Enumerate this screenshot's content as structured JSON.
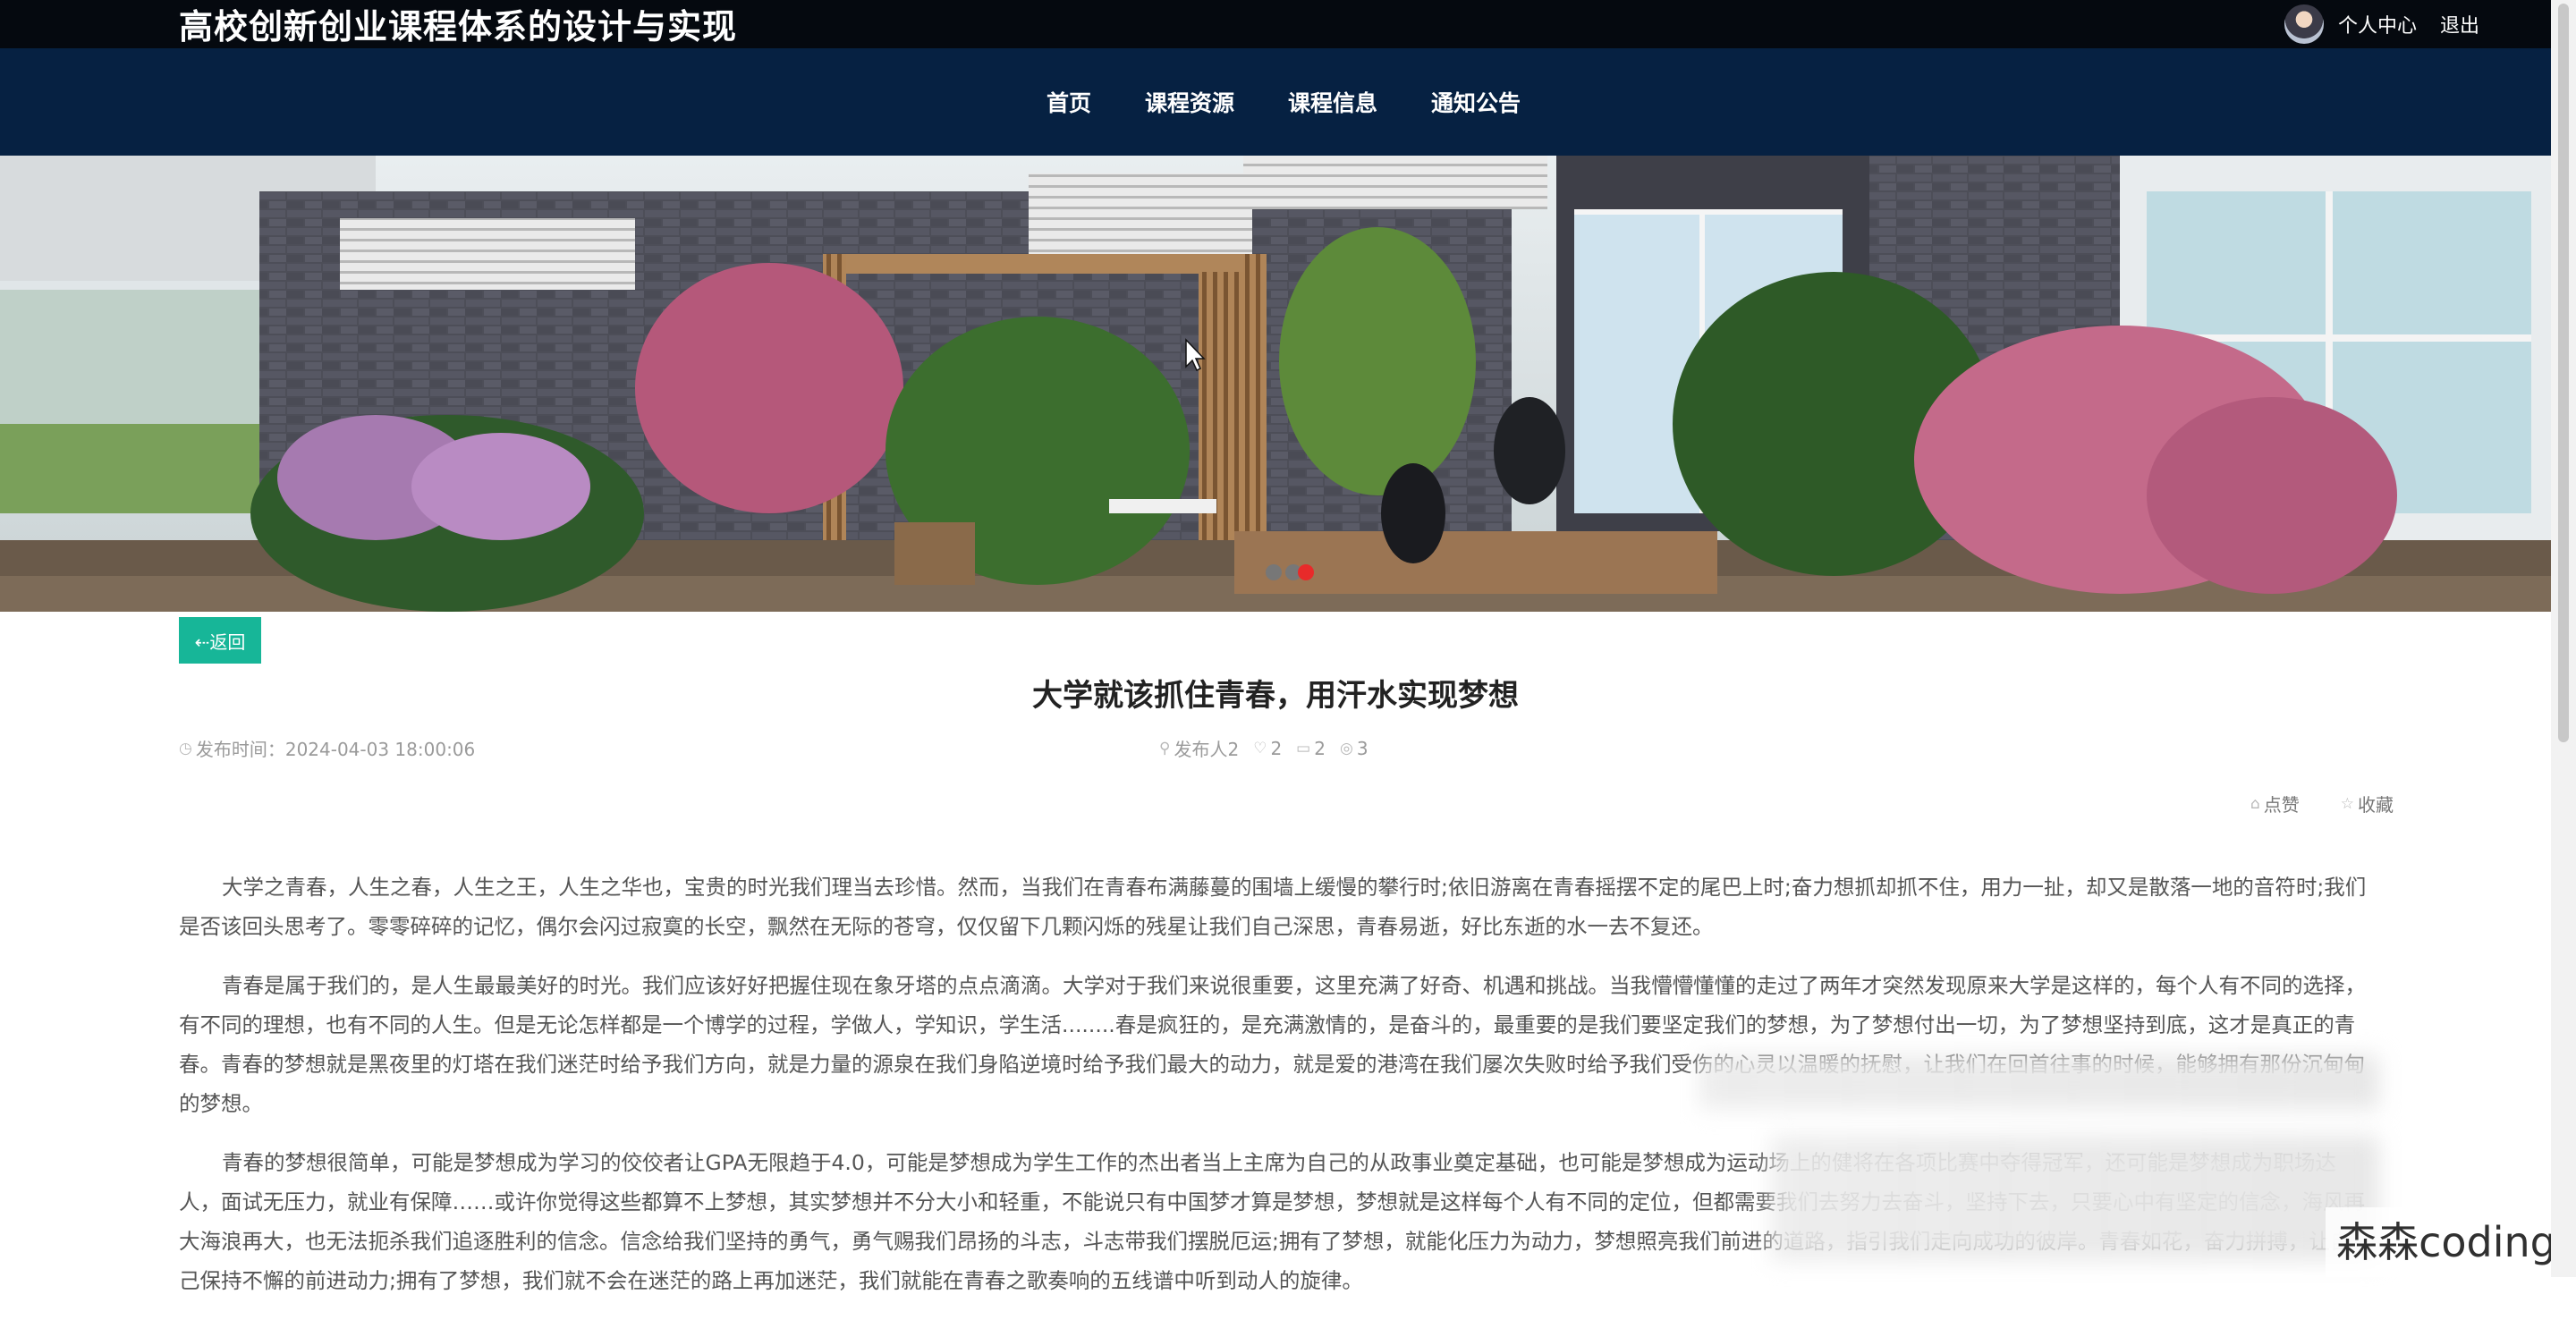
{
  "header": {
    "site_title": "高校创新创业课程体系的设计与实现",
    "user_center": "个人中心",
    "logout": "退出"
  },
  "nav": {
    "items": [
      {
        "label": "首页"
      },
      {
        "label": "课程资源"
      },
      {
        "label": "课程信息"
      },
      {
        "label": "通知公告"
      }
    ]
  },
  "banner": {
    "active_dot": 2,
    "dot_count": 3
  },
  "article": {
    "back_label": "⇠返回",
    "title": "大学就该抓住青春，用汗水实现梦想",
    "publish_time": "发布时间：2024-04-03 18:00:06",
    "publisher": "发布人2",
    "likes": "2",
    "comments": "2",
    "views": "3",
    "like_action": "点赞",
    "collect_action": "收藏",
    "paragraphs": [
      "大学之青春，人生之春，人生之王，人生之华也，宝贵的时光我们理当去珍惜。然而，当我们在青春布满藤蔓的围墙上缓慢的攀行时;依旧游离在青春摇摆不定的尾巴上时;奋力想抓却抓不住，用力一扯，却又是散落一地的音符时;我们是否该回头思考了。零零碎碎的记忆，偶尔会闪过寂寞的长空，飘然在无际的苍穹，仅仅留下几颗闪烁的残星让我们自己深思，青春易逝，好比东逝的水一去不复还。",
      "青春是属于我们的，是人生最最美好的时光。我们应该好好把握住现在象牙塔的点点滴滴。大学对于我们来说很重要，这里充满了好奇、机遇和挑战。当我懵懵懂懂的走过了两年才突然发现原来大学是这样的，每个人有不同的选择，有不同的理想，也有不同的人生。但是无论怎样都是一个博学的过程，学做人，学知识，学生活........春是疯狂的，是充满激情的，是奋斗的，最重要的是我们要坚定我们的梦想，为了梦想付出一切，为了梦想坚持到底，这才是真正的青春。青春的梦想就是黑夜里的灯塔在我们迷茫时给予我们方向，就是力量的源泉在我们身陷逆境时给予我们最大的动力，就是爱的港湾在我们屡次失败时给予我们受伤的心灵以温暖的抚慰，让我们在回首往事的时候，能够拥有那份沉甸甸的梦想。",
      "青春的梦想很简单，可能是梦想成为学习的佼佼者让GPA无限趋于4.0，可能是梦想成为学生工作的杰出者当上主席为自己的从政事业奠定基础，也可能是梦想成为运动场上的健将在各项比赛中夺得冠军，还可能是梦想成为职场达人，面试无压力，就业有保障……或许你觉得这些都算不上梦想，其实梦想并不分大小和轻重，不能说只有中国梦才算是梦想，梦想就是这样每个人有不同的定位，但都需要我们去努力去奋斗，坚持下去，只要心中有坚定的信念，海风再大海浪再大，也无法扼杀我们追逐胜利的信念。信念给我们坚持的勇气，勇气赐我们昂扬的斗志，斗志带我们摆脱厄运;拥有了梦想，就能化压力为动力，梦想照亮我们前进的道路，指引我们走向成功的彼岸。青春如花，奋力拼搏，让自己保持不懈的前进动力;拥有了梦想，我们就不会在迷茫的路上再加迷茫，我们就能在青春之歌奏响的五线谱中听到动人的旋律。"
    ]
  },
  "watermark": "森森coding"
}
